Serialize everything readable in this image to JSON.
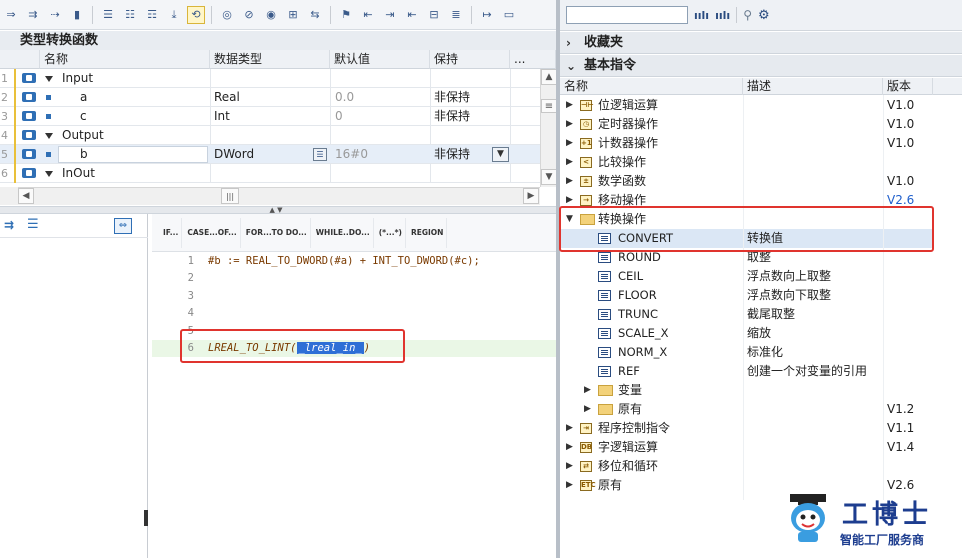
{
  "block": {
    "title": "类型转换函数",
    "columns": [
      "名称",
      "数据类型",
      "默认值",
      "保持"
    ],
    "more": "...",
    "rows": [
      {
        "num": "1",
        "name": "Input",
        "type": "",
        "default": "",
        "retain": "",
        "kind": "section"
      },
      {
        "num": "2",
        "name": "a",
        "type": "Real",
        "default": "0.0",
        "retain": "非保持",
        "kind": "var"
      },
      {
        "num": "3",
        "name": "c",
        "type": "Int",
        "default": "0",
        "retain": "非保持",
        "kind": "var"
      },
      {
        "num": "4",
        "name": "Output",
        "type": "",
        "default": "",
        "retain": "",
        "kind": "section"
      },
      {
        "num": "5",
        "name": "b",
        "type": "DWord",
        "default": "16#0",
        "retain": "非保持",
        "kind": "var"
      },
      {
        "num": "6",
        "name": "InOut",
        "type": "",
        "default": "",
        "retain": "",
        "kind": "section"
      }
    ]
  },
  "scl_toolbar": [
    {
      "line1": "IF...",
      "line2": ""
    },
    {
      "line1": "CASE...",
      "line2": "OF..."
    },
    {
      "line1": "FOR...",
      "line2": "TO DO..."
    },
    {
      "line1": "WHILE..",
      "line2": "DO..."
    },
    {
      "line1": "(*...*)",
      "line2": ""
    },
    {
      "line1": "REGION",
      "line2": ""
    }
  ],
  "code": {
    "lines": [
      {
        "n": "1",
        "text": "#b := REAL_TO_DWORD(#a) + INT_TO_DWORD(#c);"
      },
      {
        "n": "2",
        "text": ""
      },
      {
        "n": "3",
        "text": ""
      },
      {
        "n": "4",
        "text": ""
      },
      {
        "n": "5",
        "text": ""
      },
      {
        "n": "6",
        "text": "LREAL_TO_LINT("
      }
    ],
    "placeholder": "_lreal_in_",
    "close_paren": ")"
  },
  "right": {
    "favorites": "收藏夹",
    "basic": "基本指令",
    "columns": [
      "名称",
      "描述",
      "版本"
    ],
    "items": [
      {
        "label": "位逻辑运算",
        "desc": "",
        "ver": "V1.0",
        "level": 0,
        "icon": "bit-logic-icon",
        "glyph": "⊣⊢"
      },
      {
        "label": "定时器操作",
        "desc": "",
        "ver": "V1.0",
        "level": 0,
        "icon": "timer-icon",
        "glyph": "◷"
      },
      {
        "label": "计数器操作",
        "desc": "",
        "ver": "V1.0",
        "level": 0,
        "icon": "counter-icon",
        "glyph": "+1"
      },
      {
        "label": "比较操作",
        "desc": "",
        "ver": "",
        "level": 0,
        "icon": "compare-icon",
        "glyph": "<"
      },
      {
        "label": "数学函数",
        "desc": "",
        "ver": "V1.0",
        "level": 0,
        "icon": "math-icon",
        "glyph": "±"
      },
      {
        "label": "移动操作",
        "desc": "",
        "ver": "V2.6",
        "level": 0,
        "icon": "move-icon",
        "glyph": "→"
      },
      {
        "label": "转换操作",
        "desc": "",
        "ver": "",
        "level": 0,
        "icon": "convert-folder-icon",
        "glyph": "",
        "open": true
      },
      {
        "label": "CONVERT",
        "desc": "转换值",
        "ver": "",
        "level": 1,
        "icon": "instruction-icon"
      },
      {
        "label": "ROUND",
        "desc": "取整",
        "ver": "",
        "level": 1,
        "icon": "instruction-icon"
      },
      {
        "label": "CEIL",
        "desc": "浮点数向上取整",
        "ver": "",
        "level": 1,
        "icon": "instruction-icon"
      },
      {
        "label": "FLOOR",
        "desc": "浮点数向下取整",
        "ver": "",
        "level": 1,
        "icon": "instruction-icon"
      },
      {
        "label": "TRUNC",
        "desc": "截尾取整",
        "ver": "",
        "level": 1,
        "icon": "instruction-icon"
      },
      {
        "label": "SCALE_X",
        "desc": "缩放",
        "ver": "",
        "level": 1,
        "icon": "instruction-icon"
      },
      {
        "label": "NORM_X",
        "desc": "标准化",
        "ver": "",
        "level": 1,
        "icon": "instruction-icon"
      },
      {
        "label": "REF",
        "desc": "创建一个对变量的引用",
        "ver": "",
        "level": 1,
        "icon": "instruction-icon"
      },
      {
        "label": "变量",
        "desc": "",
        "ver": "",
        "level": 1,
        "icon": "folder-icon",
        "folder": true
      },
      {
        "label": "原有",
        "desc": "",
        "ver": "V1.2",
        "level": 1,
        "icon": "folder-icon",
        "folder": true
      },
      {
        "label": "程序控制指令",
        "desc": "",
        "ver": "V1.1",
        "level": 0,
        "icon": "program-control-icon",
        "glyph": "⇥"
      },
      {
        "label": "字逻辑运算",
        "desc": "",
        "ver": "V1.4",
        "level": 0,
        "icon": "word-logic-icon",
        "glyph": "DB"
      },
      {
        "label": "移位和循环",
        "desc": "",
        "ver": "",
        "level": 0,
        "icon": "shift-rotate-icon",
        "glyph": "⇄"
      },
      {
        "label": "原有",
        "desc": "",
        "ver": "V2.6",
        "level": 0,
        "icon": "legacy-icon",
        "glyph": "ETC"
      }
    ]
  },
  "watermark": {
    "title": "工博士",
    "subtitle": "智能工厂服务商"
  },
  "colors": {
    "accent": "#2e6fd6",
    "highlight": "#e0342e",
    "code": "#7a3a00",
    "version_blue": "#1f5fcc"
  }
}
